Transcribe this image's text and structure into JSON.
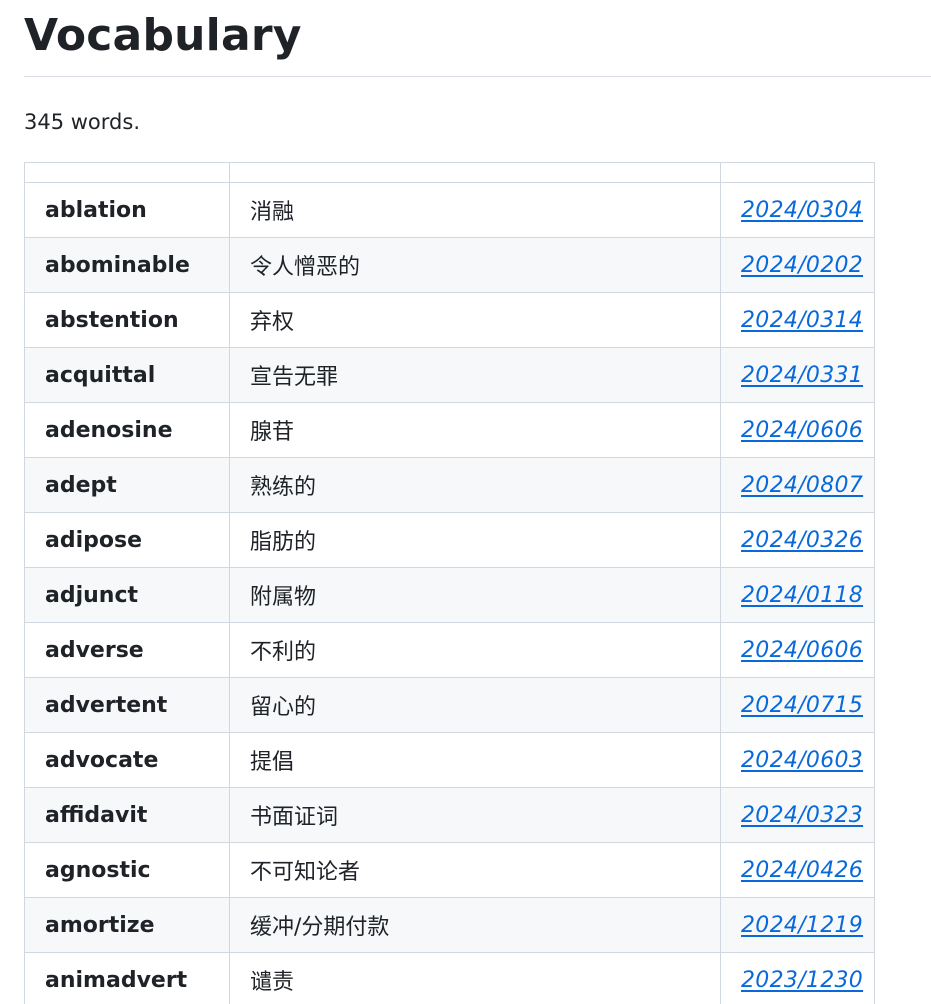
{
  "page": {
    "title": "Vocabulary",
    "word_count_text": "345 words."
  },
  "table": {
    "headers": [
      "",
      "",
      ""
    ],
    "rows": [
      {
        "word": "ablation",
        "meaning": "消融",
        "date": "2024/0304"
      },
      {
        "word": "abominable",
        "meaning": "令人憎恶的",
        "date": "2024/0202"
      },
      {
        "word": "abstention",
        "meaning": "弃权",
        "date": "2024/0314"
      },
      {
        "word": "acquittal",
        "meaning": "宣告无罪",
        "date": "2024/0331"
      },
      {
        "word": "adenosine",
        "meaning": "腺苷",
        "date": "2024/0606"
      },
      {
        "word": "adept",
        "meaning": "熟练的",
        "date": "2024/0807"
      },
      {
        "word": "adipose",
        "meaning": "脂肪的",
        "date": "2024/0326"
      },
      {
        "word": "adjunct",
        "meaning": "附属物",
        "date": "2024/0118"
      },
      {
        "word": "adverse",
        "meaning": "不利的",
        "date": "2024/0606"
      },
      {
        "word": "advertent",
        "meaning": "留心的",
        "date": "2024/0715"
      },
      {
        "word": "advocate",
        "meaning": "提倡",
        "date": "2024/0603"
      },
      {
        "word": "affidavit",
        "meaning": "书面证词",
        "date": "2024/0323"
      },
      {
        "word": "agnostic",
        "meaning": "不可知论者",
        "date": "2024/0426"
      },
      {
        "word": "amortize",
        "meaning": "缓冲/分期付款",
        "date": "2024/1219"
      },
      {
        "word": "animadvert",
        "meaning": "谴责",
        "date": "2023/1230"
      }
    ]
  },
  "colors": {
    "text": "#1f2328",
    "link": "#0969da",
    "border": "#d0d7de",
    "stripe": "#f6f8fa"
  }
}
